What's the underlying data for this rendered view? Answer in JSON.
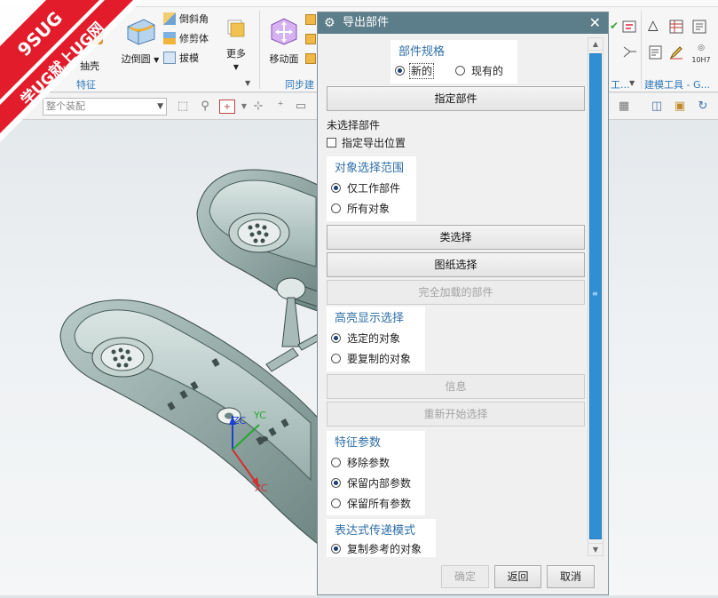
{
  "watermark": {
    "brand": "9SUG",
    "slogan": "学UG就上UG网"
  },
  "ribbon": {
    "buttons": {
      "shell": "抽壳",
      "edge_blend": "边倒圆",
      "chamfer": "倒斜角",
      "trim_body": "修剪体",
      "draft": "拔模",
      "more": "更多",
      "move_face": "移动面"
    },
    "groups": {
      "feature": "特征",
      "sync": "同步建",
      "right1": "工...",
      "modeling_tools": "建模工具 - G..."
    },
    "right_label": "10H7"
  },
  "toolbar": {
    "assembly_filter": "整个装配"
  },
  "viewport": {
    "axes": {
      "zc": "ZC",
      "yc": "YC",
      "xc": "XC"
    }
  },
  "dialog": {
    "title": "导出部件",
    "part_spec": {
      "title": "部件规格",
      "new": "新的",
      "existing": "现有的"
    },
    "specify_part": "指定部件",
    "no_part_selected": "未选择部件",
    "specify_export_location": "指定导出位置",
    "object_scope": {
      "title": "对象选择范围",
      "work_part_only": "仅工作部件",
      "all_objects": "所有对象"
    },
    "class_selection": "类选择",
    "drawing_selection": "图纸选择",
    "fully_loaded_parts": "完全加载的部件",
    "highlight": {
      "title": "高亮显示选择",
      "selected_objects": "选定的对象",
      "objects_to_copy": "要复制的对象"
    },
    "info": "信息",
    "restart_selection": "重新开始选择",
    "feature_params": {
      "title": "特征参数",
      "remove": "移除参数",
      "keep_internal": "保留内部参数",
      "keep_all": "保留所有参数"
    },
    "expression_mode": {
      "title": "表达式传递模式",
      "copy_referenced": "复制参考的对象"
    },
    "footer": {
      "ok": "确定",
      "back": "返回",
      "cancel": "取消"
    }
  }
}
